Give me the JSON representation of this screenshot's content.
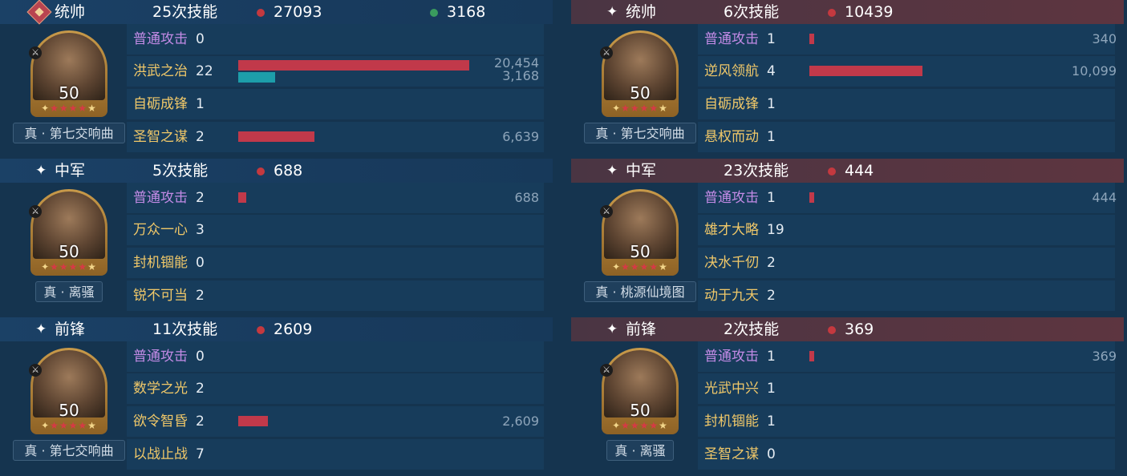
{
  "left": {
    "sections": [
      {
        "position": "统帅",
        "skills": "25次技能",
        "damage": "27093",
        "heal": "3168",
        "hero_level": "50",
        "tactic": "真 · 第七交响曲",
        "rows": [
          {
            "name": "普通攻击",
            "count": "0"
          },
          {
            "name": "洪武之治",
            "count": "22",
            "damage": "20,454",
            "heal": "3,168",
            "damage_fraction": 1.0,
            "heal_fraction": 0.16
          },
          {
            "name": "自砺成锋",
            "count": "1"
          },
          {
            "name": "圣智之谋",
            "count": "2",
            "damage": "6,639",
            "damage_fraction": 0.33
          }
        ]
      },
      {
        "position": "中军",
        "skills": "5次技能",
        "damage": "688",
        "hero_level": "50",
        "tactic": "真 · 离骚",
        "rows": [
          {
            "name": "普通攻击",
            "count": "2",
            "damage": "688",
            "damage_fraction": 0.035
          },
          {
            "name": "万众一心",
            "count": "3"
          },
          {
            "name": "封机锢能",
            "count": "0"
          },
          {
            "name": "锐不可当",
            "count": "2"
          }
        ]
      },
      {
        "position": "前锋",
        "skills": "11次技能",
        "damage": "2609",
        "hero_level": "50",
        "tactic": "真 · 第七交响曲",
        "rows": [
          {
            "name": "普通攻击",
            "count": "0"
          },
          {
            "name": "数学之光",
            "count": "2"
          },
          {
            "name": "欲令智昏",
            "count": "2",
            "damage": "2,609",
            "damage_fraction": 0.13
          },
          {
            "name": "以战止战",
            "count": "7"
          }
        ]
      }
    ]
  },
  "right": {
    "sections": [
      {
        "position": "统帅",
        "skills": "6次技能",
        "damage": "10439",
        "hero_level": "50",
        "tactic": "真 · 第七交响曲",
        "rows": [
          {
            "name": "普通攻击",
            "count": "1",
            "damage": "340",
            "damage_fraction": 0.012
          },
          {
            "name": "逆风领航",
            "count": "4",
            "damage": "10,099",
            "damage_fraction": 0.49
          },
          {
            "name": "自砺成锋",
            "count": "1"
          },
          {
            "name": "悬权而动",
            "count": "1"
          }
        ]
      },
      {
        "position": "中军",
        "skills": "23次技能",
        "damage": "444",
        "hero_level": "50",
        "tactic": "真 · 桃源仙境图",
        "rows": [
          {
            "name": "普通攻击",
            "count": "1",
            "damage": "444",
            "damage_fraction": 0.012
          },
          {
            "name": "雄才大略",
            "count": "19"
          },
          {
            "name": "决水千仞",
            "count": "2"
          },
          {
            "name": "动于九天",
            "count": "2"
          }
        ]
      },
      {
        "position": "前锋",
        "skills": "2次技能",
        "damage": "369",
        "hero_level": "50",
        "tactic": "真 · 离骚",
        "rows": [
          {
            "name": "普通攻击",
            "count": "1",
            "damage": "369",
            "damage_fraction": 0.012
          },
          {
            "name": "光武中兴",
            "count": "1"
          },
          {
            "name": "封机锢能",
            "count": "1"
          },
          {
            "name": "圣智之谋",
            "count": "0"
          }
        ]
      }
    ]
  },
  "icons": {
    "section_marker": "✦",
    "commander_badge": "commander-badge-icon",
    "weapon": "weapon-icon",
    "star_filled": "★"
  },
  "colors": {
    "damage": "#c1394a",
    "heal": "#1d9eaa",
    "normal_attack": "#c38be6",
    "skill_name": "#f0c869",
    "left_header": "#1b4166",
    "right_header": "#553541"
  }
}
